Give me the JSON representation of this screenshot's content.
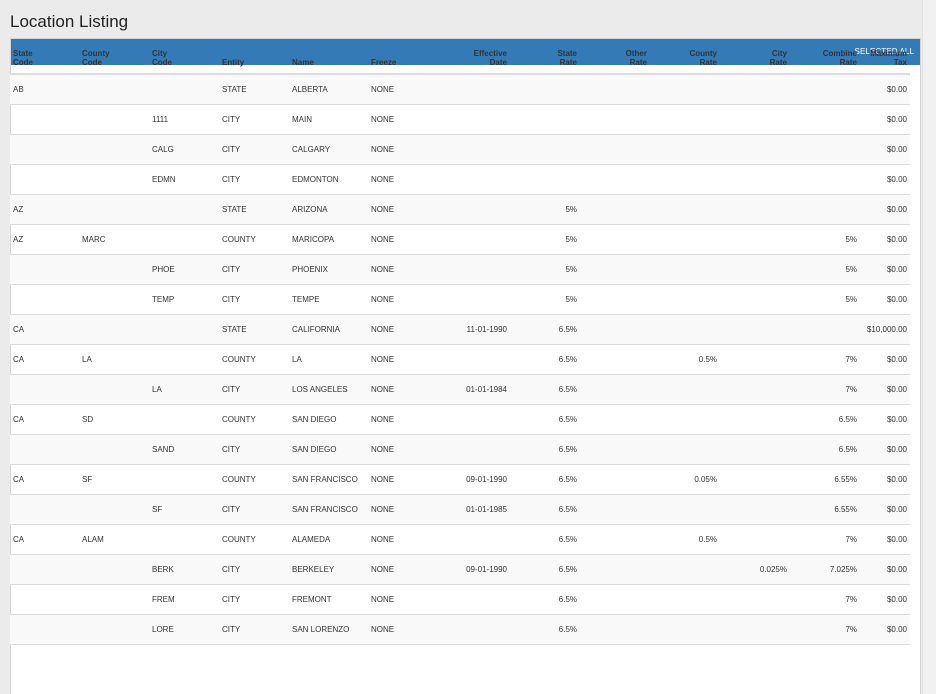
{
  "page": {
    "title": "Location Listing"
  },
  "panel": {
    "select_all_label": "SELECTED ALL"
  },
  "columns": [
    {
      "line1": "State",
      "line2": "Code"
    },
    {
      "line1": "County",
      "line2": "Code"
    },
    {
      "line1": "City",
      "line2": "Code"
    },
    {
      "line1": "",
      "line2": "Entity"
    },
    {
      "line1": "",
      "line2": "Name"
    },
    {
      "line1": "",
      "line2": "Freeze"
    },
    {
      "line1": "Effective",
      "line2": "Date"
    },
    {
      "line1": "State",
      "line2": "Rate"
    },
    {
      "line1": "Other",
      "line2": "Rate"
    },
    {
      "line1": "County",
      "line2": "Rate"
    },
    {
      "line1": "City",
      "line2": "Rate"
    },
    {
      "line1": "Combine",
      "line2": "Rate"
    },
    {
      "line1": "Maximum",
      "line2": "Tax"
    }
  ],
  "rows": [
    [
      "AB",
      "",
      "",
      "STATE",
      "ALBERTA",
      "NONE",
      "",
      "",
      "",
      "",
      "",
      "",
      "$0.00"
    ],
    [
      "",
      "",
      "1111",
      "CITY",
      "MAIN",
      "NONE",
      "",
      "",
      "",
      "",
      "",
      "",
      "$0.00"
    ],
    [
      "",
      "",
      "CALG",
      "CITY",
      "CALGARY",
      "NONE",
      "",
      "",
      "",
      "",
      "",
      "",
      "$0.00"
    ],
    [
      "",
      "",
      "EDMN",
      "CITY",
      "EDMONTON",
      "NONE",
      "",
      "",
      "",
      "",
      "",
      "",
      "$0.00"
    ],
    [
      "AZ",
      "",
      "",
      "STATE",
      "ARIZONA",
      "NONE",
      "",
      "5%",
      "",
      "",
      "",
      "",
      "$0.00"
    ],
    [
      "AZ",
      "MARC",
      "",
      "COUNTY",
      "MARICOPA",
      "NONE",
      "",
      "5%",
      "",
      "",
      "",
      "5%",
      "$0.00"
    ],
    [
      "",
      "",
      "PHOE",
      "CITY",
      "PHOENIX",
      "NONE",
      "",
      "5%",
      "",
      "",
      "",
      "5%",
      "$0.00"
    ],
    [
      "",
      "",
      "TEMP",
      "CITY",
      "TEMPE",
      "NONE",
      "",
      "5%",
      "",
      "",
      "",
      "5%",
      "$0.00"
    ],
    [
      "CA",
      "",
      "",
      "STATE",
      "CALIFORNIA",
      "NONE",
      "11-01-1990",
      "6.5%",
      "",
      "",
      "",
      "",
      "$10,000.00"
    ],
    [
      "CA",
      "LA",
      "",
      "COUNTY",
      "LA",
      "NONE",
      "",
      "6.5%",
      "",
      "0.5%",
      "",
      "7%",
      "$0.00"
    ],
    [
      "",
      "",
      "LA",
      "CITY",
      "LOS ANGELES",
      "NONE",
      "01-01-1984",
      "6.5%",
      "",
      "",
      "",
      "7%",
      "$0.00"
    ],
    [
      "CA",
      "SD",
      "",
      "COUNTY",
      "SAN DIEGO",
      "NONE",
      "",
      "6.5%",
      "",
      "",
      "",
      "6.5%",
      "$0.00"
    ],
    [
      "",
      "",
      "SAND",
      "CITY",
      "SAN DIEGO",
      "NONE",
      "",
      "6.5%",
      "",
      "",
      "",
      "6.5%",
      "$0.00"
    ],
    [
      "CA",
      "SF",
      "",
      "COUNTY",
      "SAN FRANCISCO",
      "NONE",
      "09-01-1990",
      "6.5%",
      "",
      "0.05%",
      "",
      "6.55%",
      "$0.00"
    ],
    [
      "",
      "",
      "SF",
      "CITY",
      "SAN FRANCISCO",
      "NONE",
      "01-01-1985",
      "6.5%",
      "",
      "",
      "",
      "6.55%",
      "$0.00"
    ],
    [
      "CA",
      "ALAM",
      "",
      "COUNTY",
      "ALAMEDA",
      "NONE",
      "",
      "6.5%",
      "",
      "0.5%",
      "",
      "7%",
      "$0.00"
    ],
    [
      "",
      "",
      "BERK",
      "CITY",
      "BERKELEY",
      "NONE",
      "09-01-1990",
      "6.5%",
      "",
      "",
      "0.025%",
      "7.025%",
      "$0.00"
    ],
    [
      "",
      "",
      "FREM",
      "CITY",
      "FREMONT",
      "NONE",
      "",
      "6.5%",
      "",
      "",
      "",
      "7%",
      "$0.00"
    ],
    [
      "",
      "",
      "LORE",
      "CITY",
      "SAN LORENZO",
      "NONE",
      "",
      "6.5%",
      "",
      "",
      "",
      "7%",
      "$0.00"
    ]
  ]
}
